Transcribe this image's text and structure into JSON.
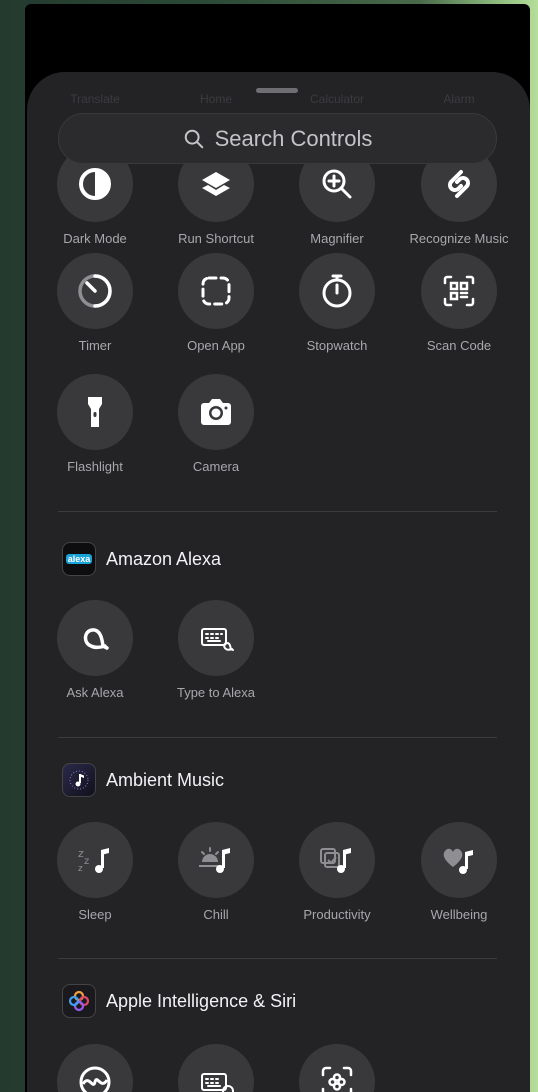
{
  "ghost_row": [
    "Translate",
    "Home",
    "Calculator",
    "Alarm"
  ],
  "search": {
    "label": "Search Controls"
  },
  "system_controls": [
    {
      "label": "Dark Mode",
      "icon": "dark-mode-icon"
    },
    {
      "label": "Run Shortcut",
      "icon": "shortcuts-icon"
    },
    {
      "label": "Magnifier",
      "icon": "magnifier-icon"
    },
    {
      "label": "Recognize Music",
      "icon": "shazam-icon"
    },
    {
      "label": "Timer",
      "icon": "timer-icon"
    },
    {
      "label": "Open App",
      "icon": "open-app-icon"
    },
    {
      "label": "Stopwatch",
      "icon": "stopwatch-icon"
    },
    {
      "label": "Scan Code",
      "icon": "qr-code-icon"
    },
    {
      "label": "Flashlight",
      "icon": "flashlight-icon"
    },
    {
      "label": "Camera",
      "icon": "camera-icon"
    }
  ],
  "sections": [
    {
      "title": "Amazon Alexa",
      "icon": "alexa-app-icon",
      "icon_text": "alexa",
      "accent": "#1aa3d8",
      "controls": [
        {
          "label": "Ask Alexa",
          "icon": "alexa-icon"
        },
        {
          "label": "Type to Alexa",
          "icon": "keyboard-alexa-icon"
        }
      ]
    },
    {
      "title": "Ambient Music",
      "icon": "ambient-music-app-icon",
      "controls": [
        {
          "label": "Sleep",
          "icon": "sleep-music-icon"
        },
        {
          "label": "Chill",
          "icon": "chill-music-icon"
        },
        {
          "label": "Productivity",
          "icon": "productivity-music-icon"
        },
        {
          "label": "Wellbeing",
          "icon": "wellbeing-music-icon"
        }
      ]
    },
    {
      "title": "Apple Intelligence & Siri",
      "icon": "apple-intelligence-app-icon",
      "controls": [
        {
          "label": "",
          "icon": "siri-icon"
        },
        {
          "label": "",
          "icon": "type-to-siri-icon"
        },
        {
          "label": "",
          "icon": "visual-intelligence-icon"
        }
      ]
    }
  ]
}
